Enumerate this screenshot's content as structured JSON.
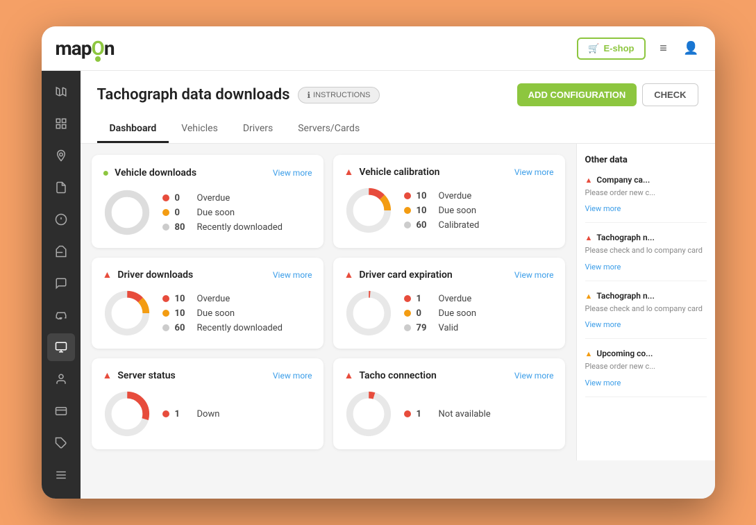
{
  "logo": {
    "text_start": "map",
    "text_highlight": "o",
    "text_end": "n"
  },
  "topbar": {
    "eshop_label": "E-shop",
    "cart_icon": "🛒"
  },
  "page": {
    "title": "Tachograph data downloads",
    "instructions_label": "INSTRUCTIONS",
    "add_config_label": "ADD CONFIGURATION",
    "check_label": "CHECK"
  },
  "tabs": [
    {
      "label": "Dashboard",
      "active": true
    },
    {
      "label": "Vehicles",
      "active": false
    },
    {
      "label": "Drivers",
      "active": false
    },
    {
      "label": "Servers/Cards",
      "active": false
    }
  ],
  "sidebar_icons": [
    {
      "name": "map-icon",
      "symbol": "🗺"
    },
    {
      "name": "grid-icon",
      "symbol": "⊞"
    },
    {
      "name": "location-icon",
      "symbol": "📍"
    },
    {
      "name": "document-icon",
      "symbol": "📄"
    },
    {
      "name": "alert-icon",
      "symbol": "⚠"
    },
    {
      "name": "fuel-icon",
      "symbol": "⛽"
    },
    {
      "name": "chat-icon",
      "symbol": "💬"
    },
    {
      "name": "car-icon",
      "symbol": "🚗"
    },
    {
      "name": "tachograph-icon",
      "symbol": "🖥"
    },
    {
      "name": "user-icon",
      "symbol": "👤"
    },
    {
      "name": "card-icon",
      "symbol": "🪪"
    },
    {
      "name": "tag-icon",
      "symbol": "🏷"
    },
    {
      "name": "bars-icon",
      "symbol": "≡"
    }
  ],
  "cards": [
    {
      "id": "vehicle-downloads",
      "title": "Vehicle downloads",
      "status": "ok",
      "viewmore": "View more",
      "stats": [
        {
          "label": "Overdue",
          "value": "0",
          "color": "red"
        },
        {
          "label": "Due soon",
          "value": "0",
          "color": "orange"
        },
        {
          "label": "Recently downloaded",
          "value": "80",
          "color": "gray"
        }
      ],
      "donut": {
        "segments": [
          {
            "color": "#ccc",
            "pct": 100
          }
        ]
      }
    },
    {
      "id": "vehicle-calibration",
      "title": "Vehicle calibration",
      "status": "warn",
      "viewmore": "View more",
      "stats": [
        {
          "label": "Overdue",
          "value": "10",
          "color": "red"
        },
        {
          "label": "Due soon",
          "value": "10",
          "color": "orange"
        },
        {
          "label": "Calibrated",
          "value": "60",
          "color": "gray"
        }
      ],
      "donut": {
        "segments": [
          {
            "color": "#e74c3c",
            "pct": 12.5
          },
          {
            "color": "#f39c12",
            "pct": 12.5
          },
          {
            "color": "#ccc",
            "pct": 75
          }
        ]
      }
    },
    {
      "id": "driver-downloads",
      "title": "Driver downloads",
      "status": "warn",
      "viewmore": "View more",
      "stats": [
        {
          "label": "Overdue",
          "value": "10",
          "color": "red"
        },
        {
          "label": "Due soon",
          "value": "10",
          "color": "orange"
        },
        {
          "label": "Recently downloaded",
          "value": "60",
          "color": "gray"
        }
      ],
      "donut": {
        "segments": [
          {
            "color": "#e74c3c",
            "pct": 12.5
          },
          {
            "color": "#f39c12",
            "pct": 12.5
          },
          {
            "color": "#ccc",
            "pct": 75
          }
        ]
      }
    },
    {
      "id": "driver-card-expiration",
      "title": "Driver card expiration",
      "status": "warn",
      "viewmore": "View more",
      "stats": [
        {
          "label": "Overdue",
          "value": "1",
          "color": "red"
        },
        {
          "label": "Due soon",
          "value": "0",
          "color": "orange"
        },
        {
          "label": "Valid",
          "value": "79",
          "color": "gray"
        }
      ],
      "donut": {
        "segments": [
          {
            "color": "#e74c3c",
            "pct": 1.25
          },
          {
            "color": "#ccc",
            "pct": 98.75
          }
        ]
      }
    },
    {
      "id": "server-status",
      "title": "Server status",
      "status": "warn",
      "viewmore": "View more",
      "stats": [
        {
          "label": "Down",
          "value": "1",
          "color": "red"
        }
      ],
      "donut": {
        "segments": [
          {
            "color": "#e74c3c",
            "pct": 30
          },
          {
            "color": "#ccc",
            "pct": 70
          }
        ]
      }
    },
    {
      "id": "tacho-connection",
      "title": "Tacho connection",
      "status": "warn",
      "viewmore": "View more",
      "stats": [
        {
          "label": "Not available",
          "value": "1",
          "color": "red"
        }
      ],
      "donut": {
        "segments": [
          {
            "color": "#e74c3c",
            "pct": 5
          },
          {
            "color": "#ccc",
            "pct": 95
          }
        ]
      }
    }
  ],
  "right_panel": {
    "title": "Other data",
    "items": [
      {
        "id": "company-card",
        "title": "Company ca...",
        "severity": "red",
        "description": "Please order new c...",
        "viewmore": "View more"
      },
      {
        "id": "tachograph-1",
        "title": "Tachograph n...",
        "severity": "red",
        "description": "Please check and lo company card",
        "viewmore": "View more"
      },
      {
        "id": "tachograph-2",
        "title": "Tachograph n...",
        "severity": "yellow",
        "description": "Please check and lo company card",
        "viewmore": "View more"
      },
      {
        "id": "upcoming",
        "title": "Upcoming co...",
        "severity": "yellow",
        "description": "Please order new c...",
        "viewmore": "View more"
      }
    ]
  }
}
